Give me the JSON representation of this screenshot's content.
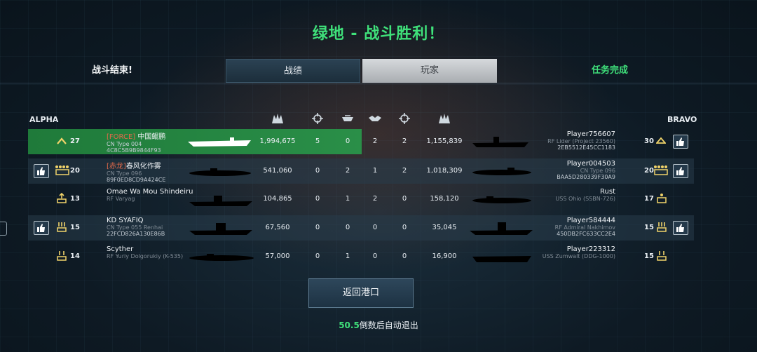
{
  "title": "绿地 - 战斗胜利！",
  "header": {
    "battle_over": "战斗结束!",
    "tabs": [
      {
        "label": "战绩"
      },
      {
        "label": "玩家"
      }
    ],
    "mission_complete": "任务完成"
  },
  "teams": {
    "left": "ALPHA",
    "right": "BRAVO"
  },
  "column_icons": [
    "damage-icon",
    "crosshair-icon",
    "ship-kill-icon",
    "handshake-icon",
    "crosshair-icon",
    "damage-icon"
  ],
  "rows": [
    {
      "left": {
        "rank": "27",
        "tag": "[FORCE]",
        "name": "中国鲲鹏",
        "ship": "CN Type 004",
        "id": "4C8C5B9B9844F93",
        "damage": "1,994,675",
        "kills": "5",
        "assists": "0"
      },
      "right": {
        "assists": "2",
        "kills": "2",
        "damage": "1,155,839",
        "name": "Player756607",
        "ship": "RF Lider (Project 23560)",
        "id": "2EB5512E45CC1183",
        "rank": "30"
      }
    },
    {
      "left": {
        "rank": "20",
        "tag": "[赤龙]",
        "name": "春风化作雾",
        "ship": "CN Type 096",
        "id": "89F0ED8CD9A424CE",
        "damage": "541,060",
        "kills": "0",
        "assists": "2"
      },
      "right": {
        "assists": "1",
        "kills": "2",
        "damage": "1,018,309",
        "name": "Player004503",
        "ship": "CN Type 096",
        "id": "BAA5D280339F30A9",
        "rank": "20"
      }
    },
    {
      "left": {
        "rank": "13",
        "tag": "",
        "name": "Omae Wa Mou Shindeiru",
        "ship": "RF Varyag",
        "id": "",
        "damage": "104,865",
        "kills": "0",
        "assists": "1"
      },
      "right": {
        "assists": "2",
        "kills": "0",
        "damage": "158,120",
        "name": "Rust",
        "ship": "USS Ohio (SSBN-726)",
        "id": "",
        "rank": "17"
      }
    },
    {
      "left": {
        "rank": "15",
        "tag": "",
        "name": "KD SYAFIQ",
        "ship": "CN Type 055 Renhai",
        "id": "22FCD826A130E86B",
        "damage": "67,560",
        "kills": "0",
        "assists": "0"
      },
      "right": {
        "assists": "0",
        "kills": "0",
        "damage": "35,045",
        "name": "Player584444",
        "ship": "RF Admiral Nakhimov",
        "id": "450DB2FC633CC2E4",
        "rank": "15"
      }
    },
    {
      "left": {
        "rank": "14",
        "tag": "",
        "name": "Scyther",
        "ship": "RF Yuriy Dolgorukiy (K-535)",
        "id": "",
        "damage": "57,000",
        "kills": "0",
        "assists": "1"
      },
      "right": {
        "assists": "0",
        "kills": "0",
        "damage": "16,900",
        "name": "Player223312",
        "ship": "USS Zumwalt (DDG-1000)",
        "id": "",
        "rank": "15"
      }
    }
  ],
  "back_button": "返回港口",
  "countdown": {
    "seconds": "50.5",
    "suffix": "倒数后自动退出"
  },
  "colors": {
    "victory": "#3fe07a",
    "highlight": "#2a8f48",
    "clan_tag": "#e36a4a"
  }
}
